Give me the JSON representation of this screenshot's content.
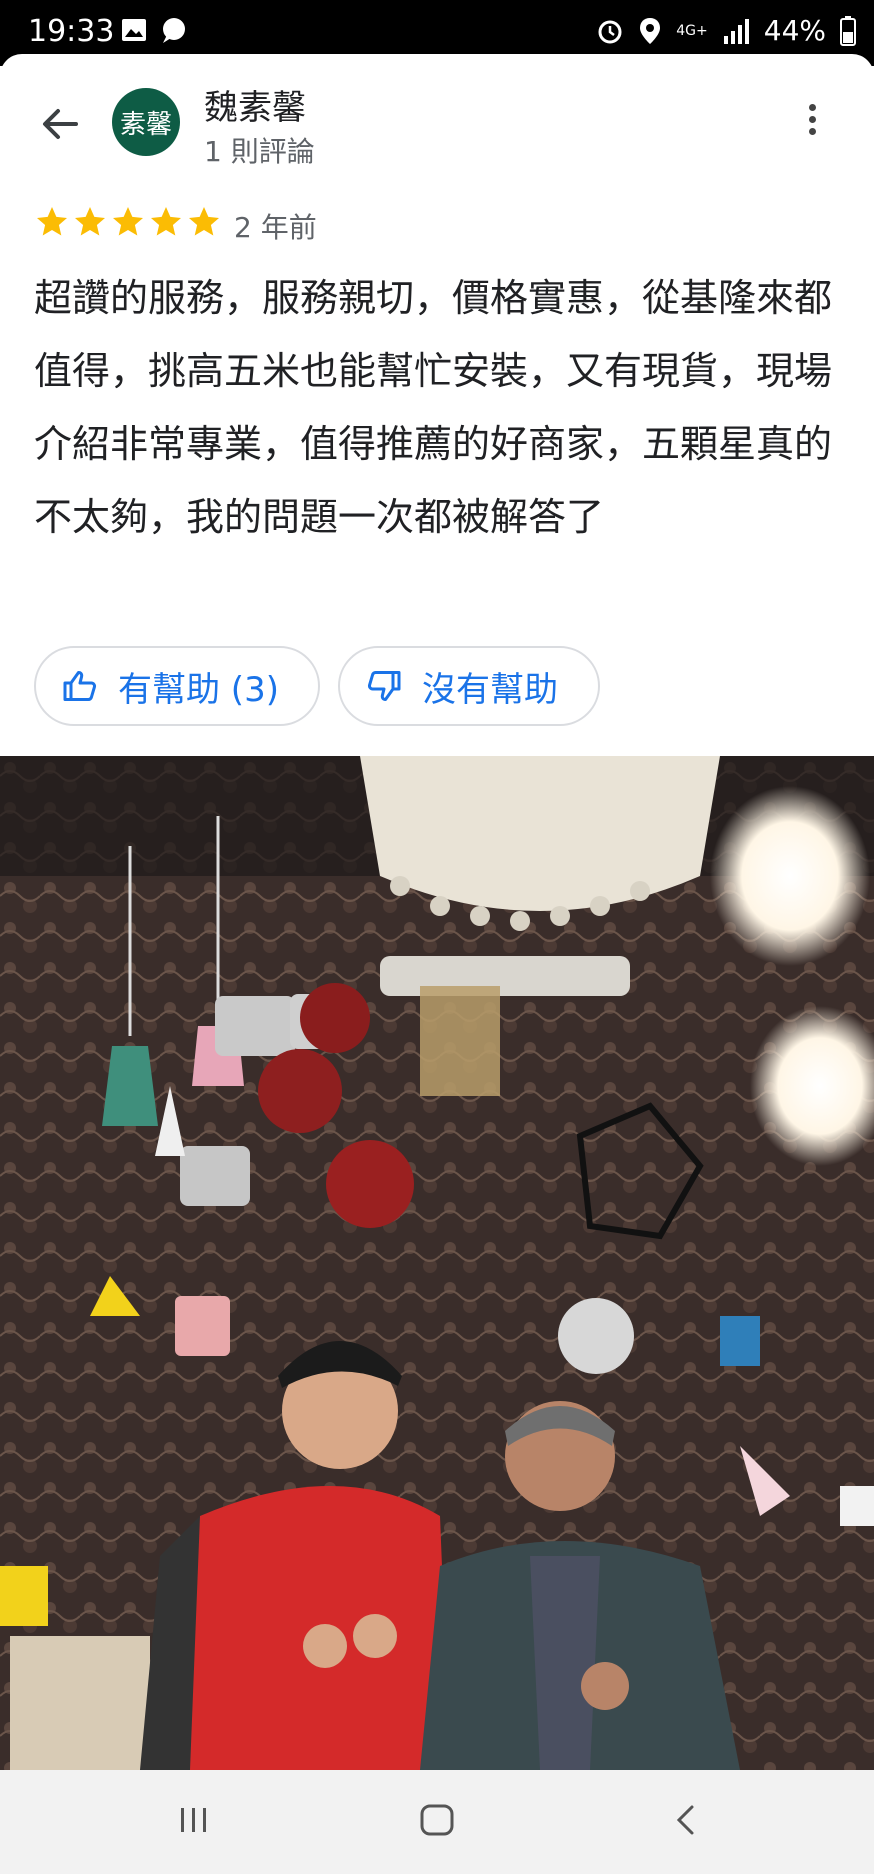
{
  "status_bar": {
    "time": "19:33",
    "network": "4G+",
    "battery": "44%",
    "icons": [
      "image-icon",
      "chat-bubble-icon",
      "alarm-icon",
      "location-icon",
      "signal-icon",
      "battery-icon"
    ]
  },
  "reviewer": {
    "avatar_text": "素馨",
    "name": "魏素馨",
    "review_count": "1 則評論",
    "avatar_color": "#0e5c45"
  },
  "review": {
    "rating": 5,
    "max_rating": 5,
    "time_ago": "2 年前",
    "text": "超讚的服務，服務親切，價格實惠，從基隆來都值得，挑高五米也能幫忙安裝，又有現貨，現場介紹非常專業，值得推薦的好商家，五顆星真的不太夠，我的問題一次都被解答了"
  },
  "actions": {
    "helpful_label": "有幫助 (3)",
    "not_helpful_label": "沒有幫助"
  },
  "photo": {
    "description_icon": "review-photo"
  },
  "colors": {
    "accent": "#1a73e8",
    "star": "#fbbc04"
  }
}
